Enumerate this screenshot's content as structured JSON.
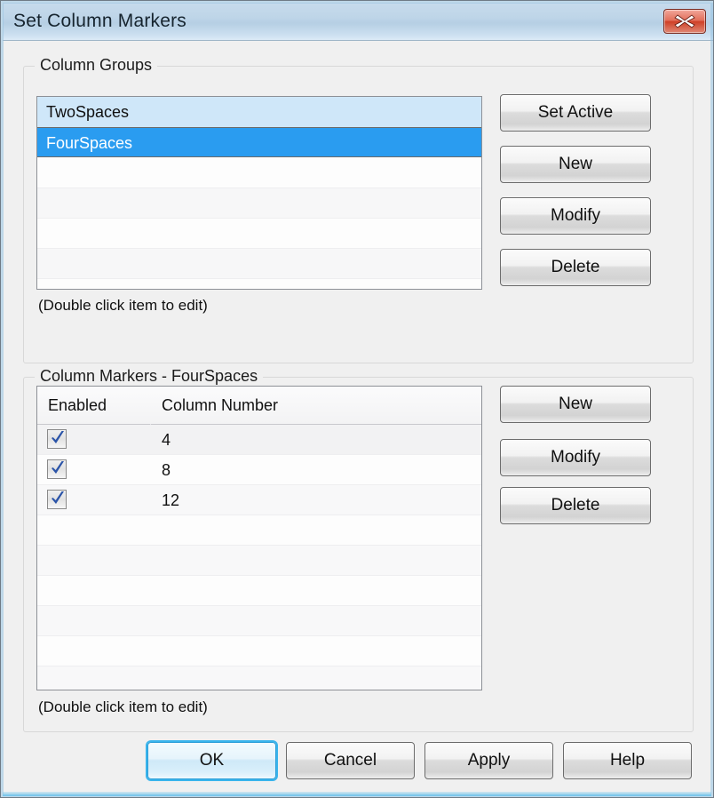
{
  "window": {
    "title": "Set Column Markers",
    "close_icon": "close-icon"
  },
  "column_groups": {
    "legend": "Column Groups",
    "items": [
      {
        "label": "TwoSpaces",
        "state": "active"
      },
      {
        "label": "FourSpaces",
        "state": "selected"
      }
    ],
    "empty_row_count": 5,
    "hint": "(Double click item to edit)",
    "buttons": [
      {
        "label": "Set Active"
      },
      {
        "label": "New"
      },
      {
        "label": "Modify"
      },
      {
        "label": "Delete"
      }
    ]
  },
  "column_markers": {
    "legend": "Column Markers - FourSpaces",
    "headers": [
      "Enabled",
      "Column Number"
    ],
    "rows": [
      {
        "enabled": true,
        "column_number": "4"
      },
      {
        "enabled": true,
        "column_number": "8"
      },
      {
        "enabled": true,
        "column_number": "12"
      }
    ],
    "empty_row_count": 6,
    "hint": "(Double click item to edit)",
    "buttons": [
      {
        "label": "New"
      },
      {
        "label": "Modify"
      },
      {
        "label": "Delete"
      }
    ]
  },
  "footer": {
    "buttons": [
      {
        "label": "OK",
        "default": true
      },
      {
        "label": "Cancel",
        "default": false
      },
      {
        "label": "Apply",
        "default": false
      },
      {
        "label": "Help",
        "default": false
      }
    ]
  },
  "colors": {
    "selection_blue": "#2a9cf0",
    "active_blue": "#cfe7f9",
    "default_button_glow": "#39b4ec",
    "close_red": "#cf4027",
    "check_blue": "#2b54a8"
  }
}
